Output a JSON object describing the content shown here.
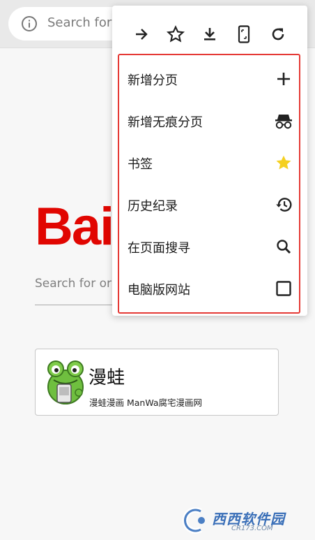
{
  "toolbar": {
    "search_placeholder": "Search for",
    "icons": [
      "info-icon"
    ]
  },
  "logo": {
    "text": "Bai"
  },
  "main_search": {
    "placeholder": "Search for or"
  },
  "card": {
    "title": "漫蛙",
    "subtitle": "漫蛙漫画 ManWa腐宅漫画网"
  },
  "menu": {
    "toolbar_icons": [
      "forward-icon",
      "star-outline-icon",
      "download-icon",
      "mobile-icon",
      "refresh-icon"
    ],
    "items": [
      {
        "label": "新增分页",
        "icon": "plus-icon"
      },
      {
        "label": "新增无痕分页",
        "icon": "incognito-icon"
      },
      {
        "label": "书签",
        "icon": "star-filled-icon"
      },
      {
        "label": "历史纪录",
        "icon": "history-icon"
      },
      {
        "label": "在页面搜寻",
        "icon": "search-icon"
      },
      {
        "label": "电脑版网站",
        "icon": "checkbox-icon"
      }
    ]
  },
  "watermark": {
    "main": "西西软件园",
    "sub": "CR173.COM"
  },
  "colors": {
    "logo_red": "#e10601",
    "highlight_border": "#e53935",
    "bookmark_star": "#f5d020",
    "watermark_blue": "#3a6fb8"
  }
}
